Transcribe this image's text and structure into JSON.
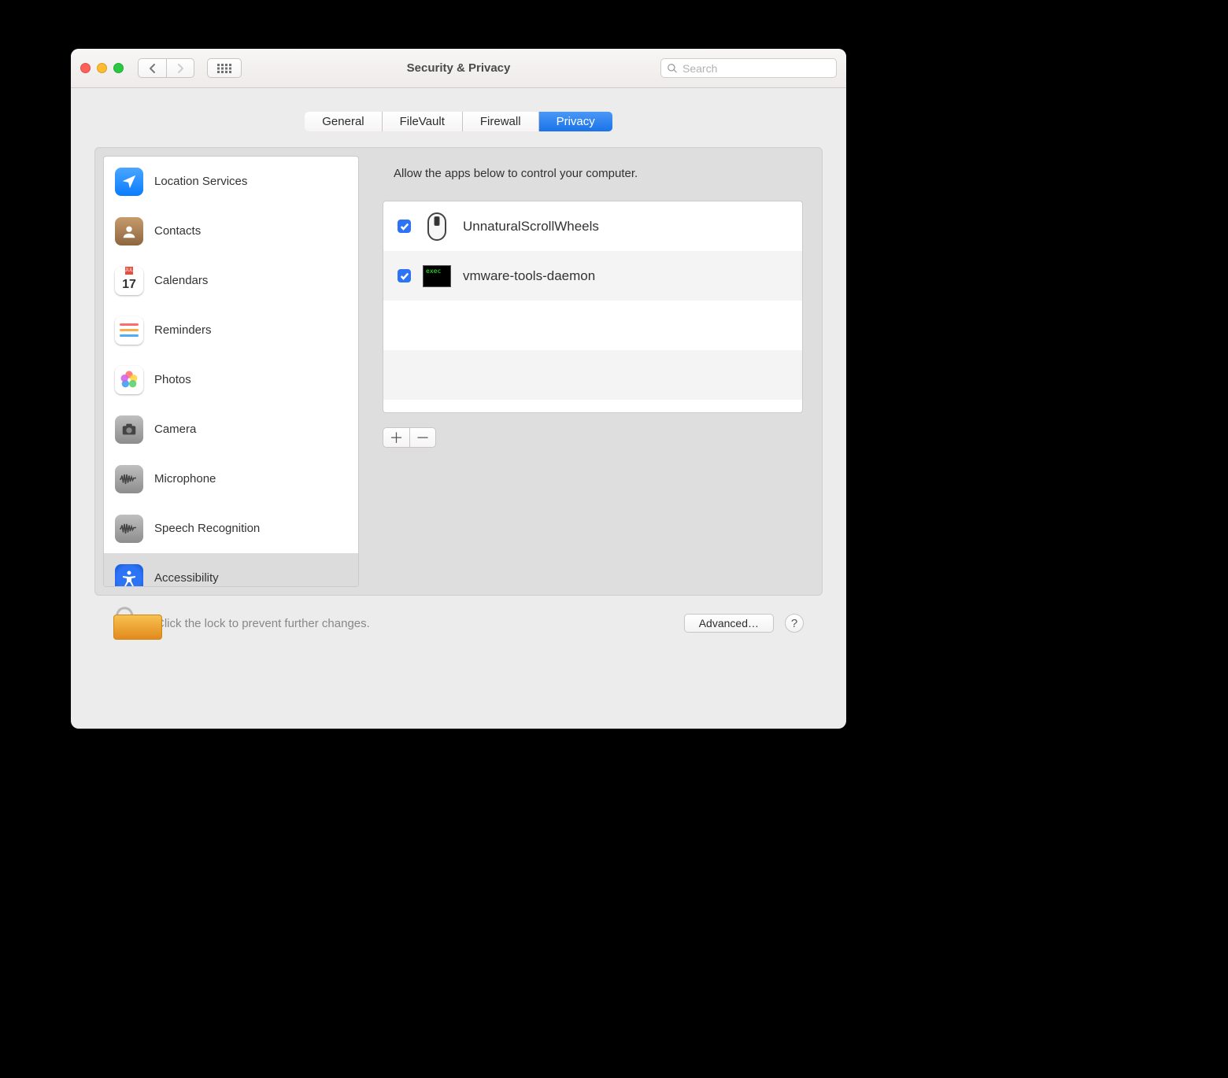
{
  "window_title": "Security & Privacy",
  "search_placeholder": "Search",
  "tabs": {
    "general": "General",
    "filevault": "FileVault",
    "firewall": "Firewall",
    "privacy": "Privacy"
  },
  "active_tab": "privacy",
  "sidebar": {
    "items": [
      {
        "label": "Location Services",
        "icon": "location"
      },
      {
        "label": "Contacts",
        "icon": "contacts"
      },
      {
        "label": "Calendars",
        "icon": "calendar"
      },
      {
        "label": "Reminders",
        "icon": "reminders"
      },
      {
        "label": "Photos",
        "icon": "photos"
      },
      {
        "label": "Camera",
        "icon": "camera"
      },
      {
        "label": "Microphone",
        "icon": "microphone"
      },
      {
        "label": "Speech Recognition",
        "icon": "speech"
      },
      {
        "label": "Accessibility",
        "icon": "accessibility",
        "selected": true
      }
    ]
  },
  "calendar_icon": {
    "month": "JUL",
    "day": "17"
  },
  "main": {
    "description": "Allow the apps below to control your computer.",
    "apps": [
      {
        "name": "UnnaturalScrollWheels",
        "checked": true,
        "icon": "mouse"
      },
      {
        "name": "vmware-tools-daemon",
        "checked": true,
        "icon": "terminal"
      }
    ],
    "terminal_prompt": "exec"
  },
  "footer": {
    "lock_text": "Click the lock to prevent further changes.",
    "advanced_label": "Advanced…"
  }
}
